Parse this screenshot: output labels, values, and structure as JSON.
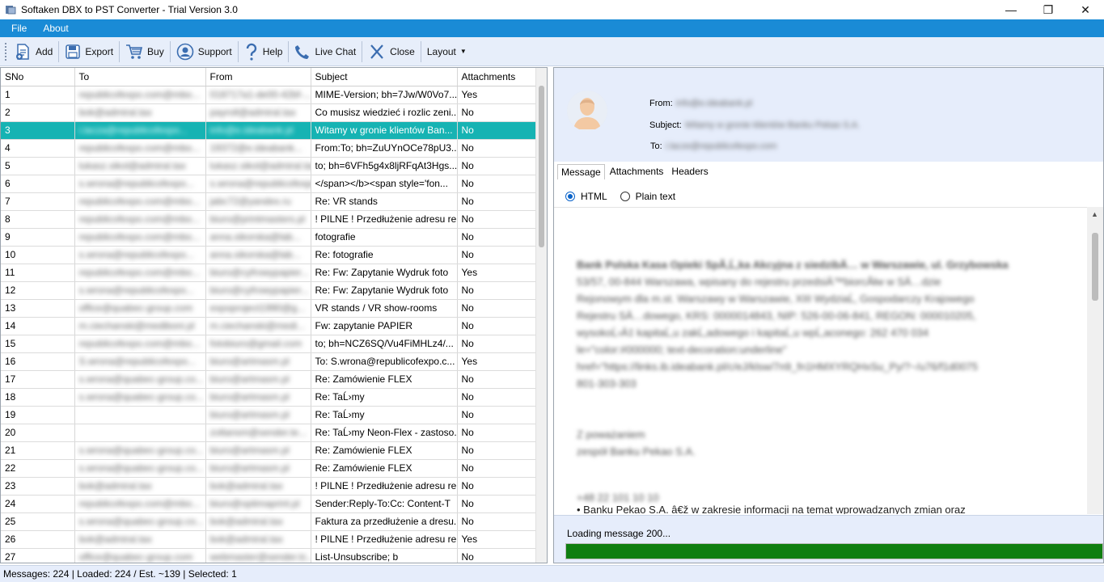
{
  "window": {
    "title": "Softaken DBX to PST Converter - Trial Version 3.0",
    "min_icon": "minimize-icon",
    "max_icon": "maximize-icon",
    "close_icon": "close-icon"
  },
  "menu": [
    "File",
    "About"
  ],
  "toolbar": {
    "add": "Add",
    "export": "Export",
    "buy": "Buy",
    "support": "Support",
    "help": "Help",
    "live_chat": "Live Chat",
    "close": "Close",
    "layout": "Layout"
  },
  "list": {
    "headers": [
      "SNo",
      "To",
      "From",
      "Subject",
      "Attachments"
    ],
    "selected_sno": "3",
    "rows": [
      {
        "sno": "1",
        "to": "republicofexpo.com@mbo...",
        "from": "018717a1-de00-42bf-...",
        "subject": "MIME-Version; bh=7Jw/W0Vo7...",
        "att": "Yes"
      },
      {
        "sno": "2",
        "to": "bok@admiral.tax",
        "from": "payroll@admiral.tax",
        "subject": "Co musisz wiedzieć i rozlic zeni...",
        "att": "No"
      },
      {
        "sno": "3",
        "to": "i.lacza@republicofexpo...",
        "from": "info@e.ideabank.pl",
        "subject": "Witamy w gronie klientów Ban...",
        "att": "No"
      },
      {
        "sno": "4",
        "to": "republicofexpo.com@mbo...",
        "from": "19372@e.ideabank...",
        "subject": "From:To; bh=ZuUYnOCe78pU3...",
        "att": "No"
      },
      {
        "sno": "5",
        "to": "lukasz.sikol@admiral.tax",
        "from": "lukasz.sikol@admiral.tax",
        "subject": "to; bh=6VFh5g4x8ljRFqAt3Hgs...",
        "att": "No"
      },
      {
        "sno": "6",
        "to": "s.wrona@republicofexpo...",
        "from": "s.wrona@republicofexpo...",
        "subject": "</span></b><span style='fon...",
        "att": "No"
      },
      {
        "sno": "7",
        "to": "republicofexpo.com@mbo...",
        "from": "jabc72@yandex.ru",
        "subject": "Re: VR stands",
        "att": "No"
      },
      {
        "sno": "8",
        "to": "republicofexpo.com@mbo...",
        "from": "biuro@printmasters.pl",
        "subject": "! PILNE ! Przedłużenie adresu re...",
        "att": "No"
      },
      {
        "sno": "9",
        "to": "republicofexpo.com@mbo...",
        "from": "anna.sikorska@lab...",
        "subject": "fotografie",
        "att": "No"
      },
      {
        "sno": "10",
        "to": "s.wrona@republicofexpo...",
        "from": "anna.sikorska@lab...",
        "subject": "Re: fotografie",
        "att": "No"
      },
      {
        "sno": "11",
        "to": "republicofexpo.com@mbo...",
        "from": "biuro@cyfrowypapier...",
        "subject": "Re: Fw: Zapytanie Wydruk foto",
        "att": "Yes"
      },
      {
        "sno": "12",
        "to": "s.wrona@republicofexpo...",
        "from": "biuro@cyfrowypapier...",
        "subject": "Re: Fw: Zapytanie Wydruk foto",
        "att": "No"
      },
      {
        "sno": "13",
        "to": "office@quabec-group.com",
        "from": "expoproject1990@g...",
        "subject": "VR stands / VR show-rooms",
        "att": "No"
      },
      {
        "sno": "14",
        "to": "m.ciechanski@mediboni.pl",
        "from": "m.ciechanski@medi...",
        "subject": "Fw: zapytanie PAPIER",
        "att": "No"
      },
      {
        "sno": "15",
        "to": "republicofexpo.com@mbo...",
        "from": "fotobiuro@gmail.com",
        "subject": "to; bh=NCZ6SQ/Vu4FiMHLz4/...",
        "att": "No"
      },
      {
        "sno": "16",
        "to": "S.wrona@republicofexpo...",
        "from": "biuro@artmasm.pl",
        "subject": "To: S.wrona@republicofexpo.c...",
        "att": "Yes"
      },
      {
        "sno": "17",
        "to": "s.wrona@quabec-group.co...",
        "from": "biuro@artmasm.pl",
        "subject": "Re: Zamówienie FLEX",
        "att": "No"
      },
      {
        "sno": "18",
        "to": "s.wrona@quabec-group.co...",
        "from": "biuro@artmasm.pl",
        "subject": "Re: TaĹ›my",
        "att": "No"
      },
      {
        "sno": "19",
        "to": "",
        "from": "biuro@artmasm.pl",
        "subject": "Re: TaĹ›my",
        "att": "No"
      },
      {
        "sno": "20",
        "to": "",
        "from": "zoltansm@sender.te...",
        "subject": "Re: TaĹ›my Neon-Flex - zastoso...",
        "att": "No"
      },
      {
        "sno": "21",
        "to": "s.wrona@quabec-group.co...",
        "from": "biuro@artmasm.pl",
        "subject": "Re: Zamówienie FLEX",
        "att": "No"
      },
      {
        "sno": "22",
        "to": "s.wrona@quabec-group.co...",
        "from": "biuro@artmasm.pl",
        "subject": "Re: Zamówienie FLEX",
        "att": "No"
      },
      {
        "sno": "23",
        "to": "bok@admiral.tax",
        "from": "bok@admiral.tax",
        "subject": "! PILNE ! Przedłużenie adresu re...",
        "att": "No"
      },
      {
        "sno": "24",
        "to": "republicofexpo.com@mbo...",
        "from": "biuro@optimaprint.pl",
        "subject": "Sender:Reply-To:Cc: Content-T",
        "att": "No"
      },
      {
        "sno": "25",
        "to": "s.wrona@quabec-group.co...",
        "from": "bok@admiral.tax",
        "subject": "Faktura za przedłużenie a dresu...",
        "att": "No"
      },
      {
        "sno": "26",
        "to": "bok@admiral.tax",
        "from": "bok@admiral.tax",
        "subject": "! PILNE ! Przedłużenie adresu re...",
        "att": "Yes"
      },
      {
        "sno": "27",
        "to": "office@quabec-group.com",
        "from": "webmaster@sender.tc...",
        "subject": "List-Unsubscribe; b",
        "att": "No"
      }
    ]
  },
  "preview": {
    "from_label": "From:",
    "from_value": "info@e.ideabank.pl",
    "subject_label": "Subject:",
    "subject_value": "Witamy w gronie klientów Banku Pekao S.A.",
    "to_label": "To:",
    "to_value": "i.lacze@republicofexpo.com",
    "tabs": [
      "Message",
      "Attachments",
      "Headers"
    ],
    "active_tab": "Message",
    "format_html": "HTML",
    "format_plain": "Plain text",
    "body_lines": [
      "Bank Polska Kasa Opieki SpĂ‚Ĺ‚ka Akcyjna z siedzibÄ… w Warszawie, ul. Grzybowska",
      "53/57, 00-844 Warszawa, wpisany do rejestru przedsiÄ™biorcĂłw w SÄ…dzie",
      "Rejonowym dla m.st. Warszawy w Warszawie, XIII WydziaĹ‚ Gospodarczy Krajowego",
      "Rejestru SÄ…dowego, KRS: 0000014843, NIP: 526-00-06-841, REGON: 000010205,",
      "wysokoĹ›Ä‡ kapitaĹ‚u zakĹ‚adowego i kapitaĹ‚u wpĹ‚aconego: 262 470 034",
      "le=\"color:#000000; text-decoration:underline\"",
      "href=\"https://links.ib.ideabank.pl/c/eJ/klsw/7n9_fn1HMXYRQHxSu_Py/?~/u76/f1d0075",
      "801-303-303"
    ],
    "body_greeting_1": "Z poważaniem",
    "body_greeting_2": "zespół Banku Pekao S.A.",
    "body_phone": "+48 22 101 10 10",
    "body_bullet": "Banku Pekao S.A. â€ž w zakresie informacji na temat wprowadzanych zmian oraz",
    "loading_text": "Loading message 200...",
    "progress": 1.0
  },
  "status": "Messages: 224  |  Loaded: 224 / Est. ~139  |  Selected: 1",
  "colors": {
    "menubar": "#1a8bd6",
    "selected_row": "#16b3b3",
    "progress": "#0f7e10"
  }
}
